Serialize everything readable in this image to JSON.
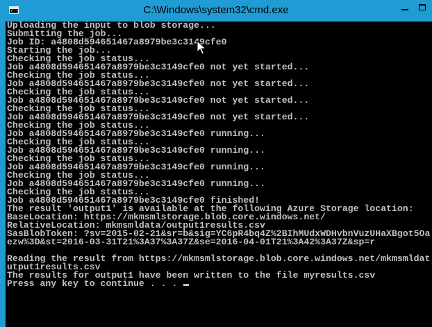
{
  "window": {
    "title": "C:\\Windows\\system32\\cmd.exe",
    "app_icon": "cmd-icon",
    "controls": [
      "minimize-icon",
      "maximize-icon"
    ],
    "accent_color": "#1f9cd4",
    "console_bg": "#000000",
    "console_fg": "#c0c0c0"
  },
  "console": {
    "lines": [
      "Uploading the input to blob storage...",
      "Submitting the job...",
      "Job ID: a4808d594651467a8979be3c3149cfe0",
      "Starting the job...",
      "Checking the job status...",
      "Job a4808d594651467a8979be3c3149cfe0 not yet started...",
      "Checking the job status...",
      "Job a4808d594651467a8979be3c3149cfe0 not yet started...",
      "Checking the job status...",
      "Job a4808d594651467a8979be3c3149cfe0 not yet started...",
      "Checking the job status...",
      "Job a4808d594651467a8979be3c3149cfe0 not yet started...",
      "Checking the job status...",
      "Job a4808d594651467a8979be3c3149cfe0 running...",
      "Checking the job status...",
      "Job a4808d594651467a8979be3c3149cfe0 running...",
      "Checking the job status...",
      "Job a4808d594651467a8979be3c3149cfe0 running...",
      "Checking the job status...",
      "Job a4808d594651467a8979be3c3149cfe0 running...",
      "Checking the job status...",
      "Job a4808d594651467a8979be3c3149cfe0 finished!",
      "The result 'output1' is available at the following Azure Storage location:",
      "BaseLocation: https://mkmsmlstorage.blob.core.windows.net/",
      "RelativeLocation: mkmsmldata/output1results.csv",
      "SasBlobToken: ?sv=2015-02-21&sr=b&sig=YC6pR4bq4Z%2BIhMUdxWDHvbnVuzUHaXBgot5Oa",
      "ezw%3D&st=2016-03-31T21%3A37%3A37Z&se=2016-04-01T21%3A42%3A37Z&sp=r",
      "",
      "Reading the result from https://mkmsmlstorage.blob.core.windows.net/mkmsmldat",
      "utput1results.csv",
      "The results for output1 have been written to the file myresults.csv",
      "Press any key to continue . . . "
    ]
  }
}
